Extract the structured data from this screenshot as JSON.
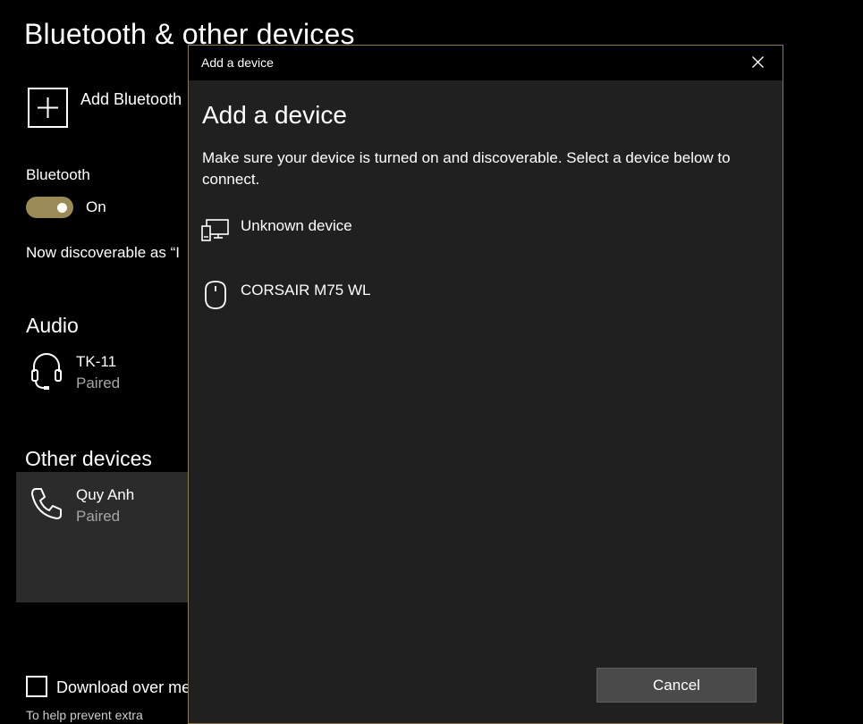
{
  "settings": {
    "title": "Bluetooth & other devices",
    "add_bluetooth_label": "Add Bluetooth",
    "bluetooth_label": "Bluetooth",
    "bluetooth_toggle_state": "On",
    "discoverable_text": "Now discoverable as “I",
    "audio_section": "Audio",
    "audio_devices": [
      {
        "name": "TK-11",
        "status": "Paired",
        "icon": "headset-icon"
      }
    ],
    "other_section": "Other devices",
    "other_devices": [
      {
        "name": "Quy Anh",
        "status": "Paired",
        "icon": "phone-icon"
      }
    ],
    "download_label": "Download over me",
    "bottom_text": "To help prevent extra"
  },
  "dialog": {
    "window_title": "Add a device",
    "heading": "Add a device",
    "description": "Make sure your device is turned on and discoverable. Select a device below to connect.",
    "devices": [
      {
        "name": "Unknown device",
        "icon": "display-device-icon"
      },
      {
        "name": "CORSAIR M75 WL",
        "icon": "mouse-icon"
      }
    ],
    "cancel_label": "Cancel"
  },
  "colors": {
    "accent": "#9a8a55",
    "dialog_background": "#202020",
    "page_background": "#000000"
  }
}
